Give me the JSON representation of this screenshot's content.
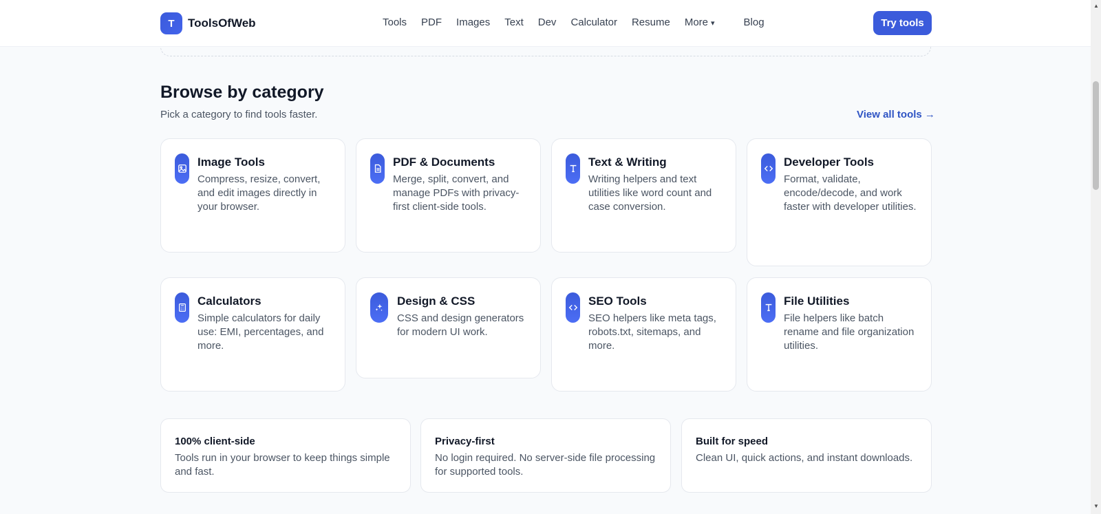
{
  "header": {
    "brand_letter": "T",
    "brand_name": "ToolsOfWeb",
    "nav": [
      "Tools",
      "PDF",
      "Images",
      "Text",
      "Dev",
      "Calculator",
      "Resume",
      "More",
      "Blog"
    ],
    "more_caret": "▾",
    "cta": "Try tools"
  },
  "section": {
    "title": "Browse by category",
    "subtitle": "Pick a category to find tools faster.",
    "view_all": "View all tools →"
  },
  "categories": [
    {
      "title": "Image Tools",
      "desc": "Compress, resize, convert, and edit images directly in your browser.",
      "icon": "image-icon"
    },
    {
      "title": "PDF & Documents",
      "desc": "Merge, split, convert, and manage PDFs with privacy-first client-side tools.",
      "icon": "document-icon"
    },
    {
      "title": "Text & Writing",
      "desc": "Writing helpers and text utilities like word count and case conversion.",
      "icon": "text-icon"
    },
    {
      "title": "Developer Tools",
      "desc": "Format, validate, encode/decode, and work faster with developer utilities.",
      "icon": "code-icon"
    },
    {
      "title": "Calculators",
      "desc": "Simple calculators for daily use: EMI, percentages, and more.",
      "icon": "calculator-icon"
    },
    {
      "title": "Design & CSS",
      "desc": "CSS and design generators for modern UI work.",
      "icon": "sparkle-icon"
    },
    {
      "title": "SEO Tools",
      "desc": "SEO helpers like meta tags, robots.txt, sitemaps, and more.",
      "icon": "code-icon"
    },
    {
      "title": "File Utilities",
      "desc": "File helpers like batch rename and file organization utilities.",
      "icon": "text-icon"
    }
  ],
  "features": [
    {
      "title": "100% client-side",
      "desc": "Tools run in your browser to keep things simple and fast."
    },
    {
      "title": "Privacy-first",
      "desc": "No login required. No server-side file processing for supported tools."
    },
    {
      "title": "Built for speed",
      "desc": "Clean UI, quick actions, and instant downloads."
    }
  ],
  "colors": {
    "accent": "#3b5bdb",
    "link": "#2f54c4",
    "background": "#f8fafc"
  }
}
